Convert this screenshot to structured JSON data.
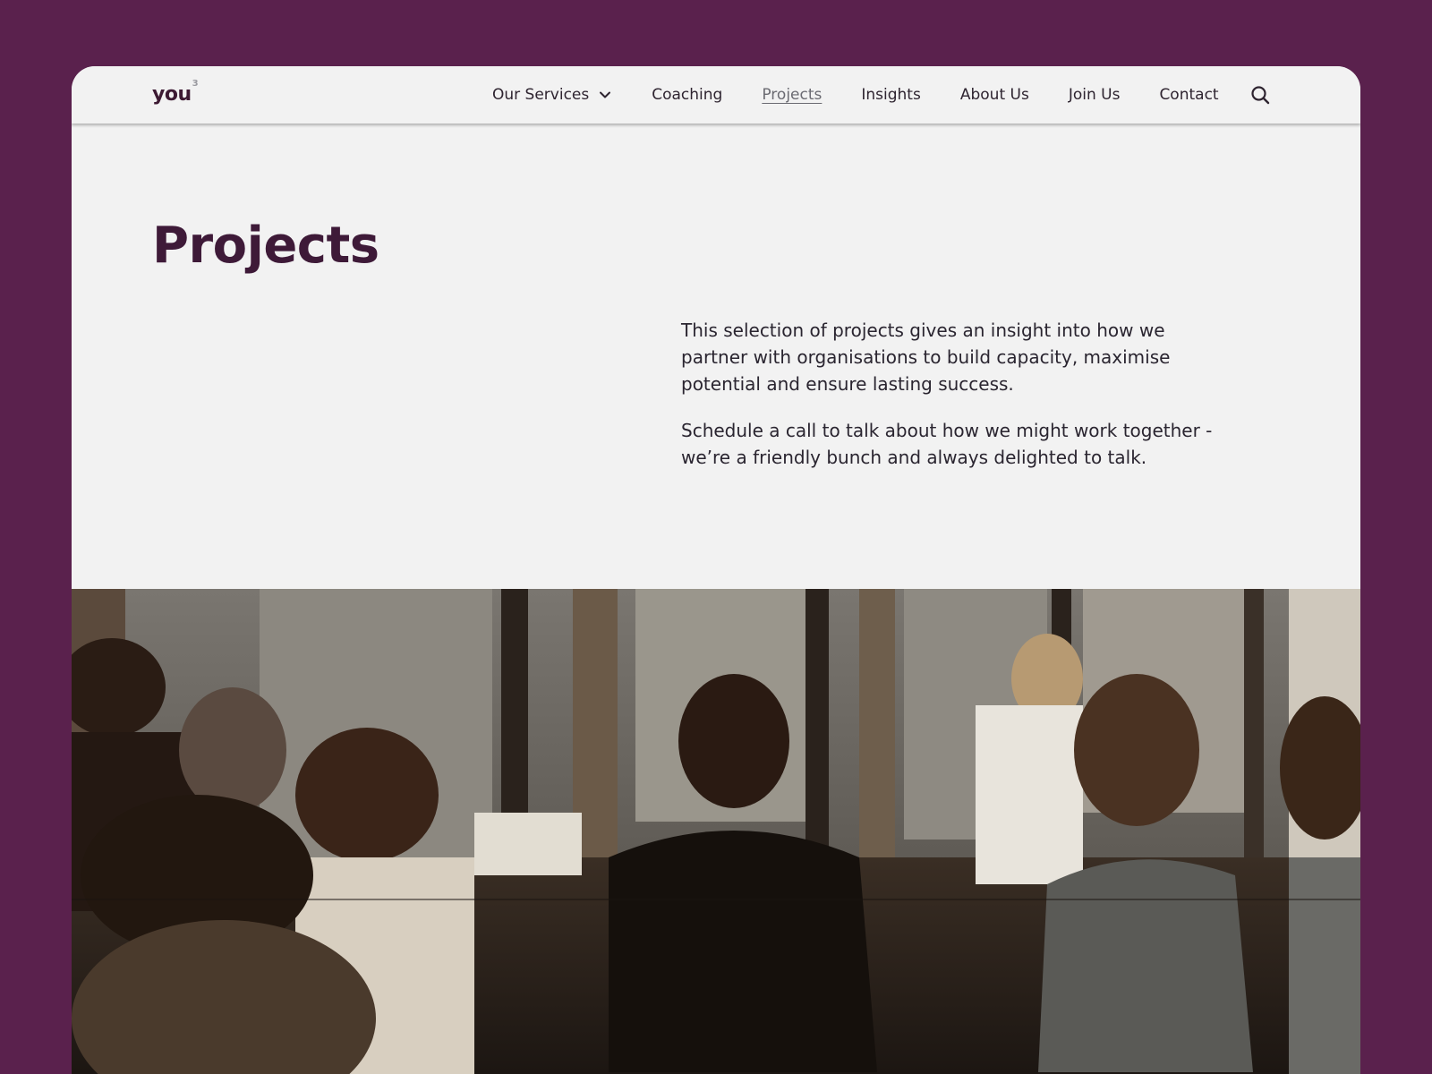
{
  "header": {
    "logo_text": "you",
    "logo_sup": "3",
    "nav": [
      {
        "label": "Our Services",
        "has_dropdown": true
      },
      {
        "label": "Coaching"
      },
      {
        "label": "Projects",
        "active": true
      },
      {
        "label": "Insights"
      },
      {
        "label": "About Us"
      },
      {
        "label": "Join Us"
      },
      {
        "label": "Contact"
      }
    ],
    "search_icon": "search-icon"
  },
  "main": {
    "title": "Projects",
    "paragraphs": [
      "This selection of projects gives an insight into how we partner with organisations to build capacity, maximise potential and ensure lasting success.",
      "Schedule a call to talk about how we might work together - we’re a friendly bunch and always delighted to talk."
    ]
  },
  "hero_image": {
    "description": "photo-of-team-meeting"
  },
  "colors": {
    "page_background": "#5a214d",
    "surface": "#f2f2f2",
    "title": "#3e1a38",
    "text": "#2a2530"
  }
}
